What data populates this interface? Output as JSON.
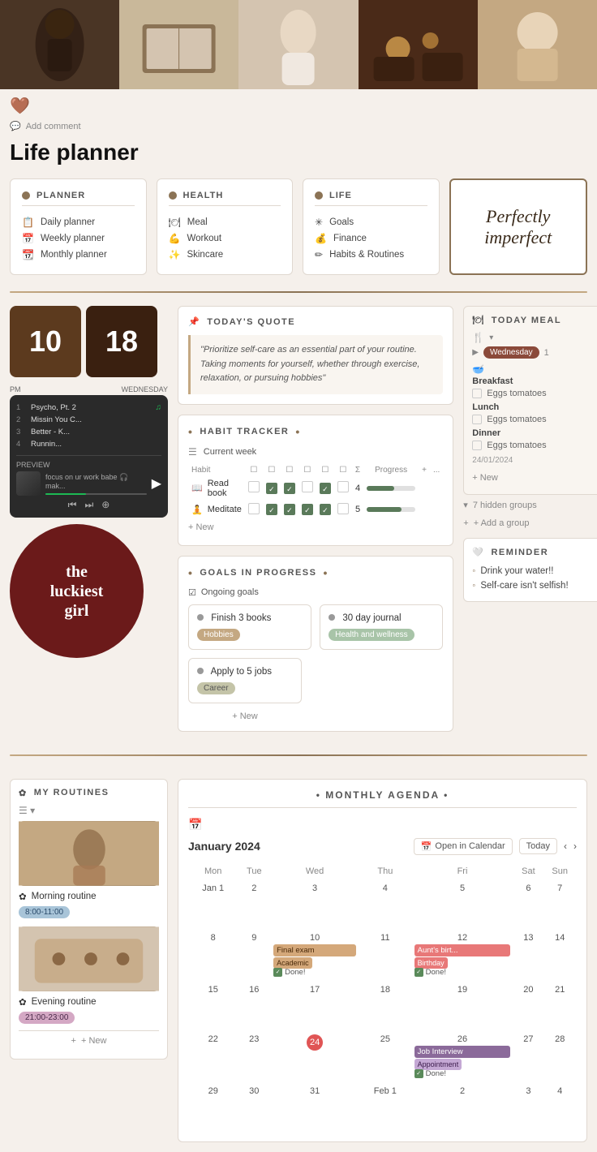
{
  "page": {
    "title": "Life planner"
  },
  "hero": {
    "images": [
      "dark-hand",
      "book-reading",
      "white-dress",
      "candle-food",
      "coffee-cozy"
    ]
  },
  "comment": {
    "label": "Add comment"
  },
  "nav": {
    "sections": [
      {
        "id": "planner",
        "title": "PLANNER",
        "items": [
          {
            "icon": "📋",
            "label": "Daily planner"
          },
          {
            "icon": "📅",
            "label": "Weekly planner"
          },
          {
            "icon": "📆",
            "label": "Monthly planner"
          }
        ]
      },
      {
        "id": "health",
        "title": "HEALTH",
        "items": [
          {
            "icon": "🍽",
            "label": "Meal"
          },
          {
            "icon": "💪",
            "label": "Workout"
          },
          {
            "icon": "✨",
            "label": "Skincare"
          }
        ]
      },
      {
        "id": "life",
        "title": "LIFE",
        "items": [
          {
            "icon": "✳",
            "label": "Goals"
          },
          {
            "icon": "💰",
            "label": "Finance"
          },
          {
            "icon": "✏",
            "label": "Habits & Routines"
          }
        ]
      }
    ],
    "special_text": [
      "Perfectly",
      "imperfect"
    ]
  },
  "clock": {
    "hour": "10",
    "minute": "18",
    "period": "PM",
    "day": "WEDNESDAY"
  },
  "music": {
    "tracks": [
      {
        "num": "1",
        "title": "Psycho, Pt. 2"
      },
      {
        "num": "2",
        "title": "Missin You C..."
      },
      {
        "num": "3",
        "title": "Better - K..."
      },
      {
        "num": "4",
        "title": "Runnin..."
      }
    ],
    "preview_label": "PREVIEW",
    "current_label": "focus on ur work babe 🎧mak..."
  },
  "luckiest": {
    "line1": "the",
    "line2": "luckiest",
    "line3": "girl"
  },
  "quote": {
    "section_title": "TODAY'S QUOTE",
    "text": "\"Prioritize self-care as an essential part of your routine. Taking moments for yourself, whether through exercise, relaxation, or pursuing hobbies\""
  },
  "habit_tracker": {
    "section_title": "HABIT TRACKER",
    "current_week_label": "Current week",
    "columns": [
      "Habit",
      "☐",
      "☐",
      "☐",
      "☐",
      "☐",
      "☐",
      "Σ",
      "Progress",
      "+",
      "..."
    ],
    "habits": [
      {
        "icon": "📖",
        "name": "Read book",
        "checks": [
          false,
          true,
          true,
          false,
          true,
          false,
          false
        ],
        "count": "4",
        "progress": 57
      },
      {
        "icon": "🧘",
        "name": "Meditate",
        "checks": [
          false,
          true,
          true,
          true,
          true,
          false,
          false
        ],
        "count": "5",
        "progress": 71
      }
    ],
    "add_label": "+ New"
  },
  "goals": {
    "section_title": "GOALS IN PROGRESS",
    "ongoing_label": "Ongoing goals",
    "items": [
      {
        "title": "Finish 3 books",
        "tag": "Hobbies",
        "tag_class": "tag-hobbies"
      },
      {
        "title": "30 day journal",
        "tag": "Health and wellness",
        "tag_class": "tag-health"
      },
      {
        "title": "Apply to 5 jobs",
        "tag": "Career",
        "tag_class": "tag-career"
      }
    ],
    "add_label": "+ New"
  },
  "today_meal": {
    "section_title": "TODAY MEAL",
    "day": "Wednesday",
    "day_num": "1",
    "meals": [
      {
        "type": "Breakfast",
        "items": [
          "Eggs tomatoes"
        ]
      },
      {
        "type": "Lunch",
        "items": [
          "Eggs tomatoes"
        ]
      },
      {
        "type": "Dinner",
        "items": [
          "Eggs tomatoes"
        ]
      }
    ],
    "date": "24/01/2024",
    "add_label": "+ New"
  },
  "hidden_groups": {
    "label": "7 hidden groups",
    "add_label": "+ Add a group"
  },
  "reminder": {
    "section_title": "REMINDER",
    "items": [
      "Drink your water!!",
      "Self-care isn't selfish!"
    ]
  },
  "routines": {
    "section_title": "MY ROUTINES",
    "items": [
      {
        "label": "Morning routine",
        "time": "8:00-11:00",
        "badge_class": "badge-morning"
      },
      {
        "label": "Evening routine",
        "time": "21:00-23:00",
        "badge_class": "badge-evening"
      }
    ],
    "add_label": "+ New"
  },
  "agenda": {
    "section_title": "MONTHLY AGENDA",
    "month": "January 2024",
    "open_calendar": "Open in Calendar",
    "today_btn": "Today",
    "days": [
      "Mon",
      "Tue",
      "Wed",
      "Thu",
      "Fri",
      "Sat",
      "Sun"
    ],
    "weeks": [
      [
        {
          "label": "Jan 1",
          "events": []
        },
        {
          "label": "2",
          "events": []
        },
        {
          "label": "3",
          "events": []
        },
        {
          "label": "4",
          "events": []
        },
        {
          "label": "5",
          "events": []
        },
        {
          "label": "6",
          "events": []
        },
        {
          "label": "7",
          "events": []
        }
      ],
      [
        {
          "label": "8",
          "events": []
        },
        {
          "label": "9",
          "events": []
        },
        {
          "label": "10",
          "events": [
            {
              "title": "Final exam",
              "tag": "Academic",
              "tag_class": "cal-event-orange",
              "done": true
            }
          ]
        },
        {
          "label": "11",
          "events": []
        },
        {
          "label": "12",
          "events": [
            {
              "title": "Aunt's birt...",
              "tag": "Birthday",
              "tag_class": "cal-event-red",
              "done": true
            }
          ]
        },
        {
          "label": "13",
          "events": []
        },
        {
          "label": "14",
          "events": []
        }
      ],
      [
        {
          "label": "15",
          "events": []
        },
        {
          "label": "16",
          "events": []
        },
        {
          "label": "17",
          "events": []
        },
        {
          "label": "18",
          "events": []
        },
        {
          "label": "19",
          "events": []
        },
        {
          "label": "20",
          "events": []
        },
        {
          "label": "21",
          "events": []
        }
      ],
      [
        {
          "label": "22",
          "events": []
        },
        {
          "label": "23",
          "events": []
        },
        {
          "label": "24",
          "today": true,
          "events": []
        },
        {
          "label": "25",
          "events": []
        },
        {
          "label": "26",
          "events": [
            {
              "title": "Job Interview",
              "tag": "Appointment",
              "tag_class": "cal-event-purple",
              "done": true
            }
          ]
        },
        {
          "label": "27",
          "events": []
        },
        {
          "label": "28",
          "events": []
        }
      ],
      [
        {
          "label": "29",
          "events": []
        },
        {
          "label": "30",
          "events": []
        },
        {
          "label": "31",
          "events": []
        },
        {
          "label": "Feb 1",
          "events": []
        },
        {
          "label": "2",
          "events": []
        },
        {
          "label": "3",
          "events": []
        },
        {
          "label": "4",
          "events": []
        }
      ]
    ]
  }
}
